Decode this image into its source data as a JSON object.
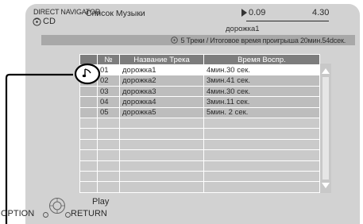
{
  "header": {
    "navigator_label": "DIRECT NAVIGATOR",
    "media_label": "CD",
    "list_title": "Список Музыки",
    "time_start": "0.09",
    "time_end": "4.30",
    "current_track": "дорожка1"
  },
  "summary": "5 Треки / Итоговое время проигрыша 20мин.54dceк.",
  "table": {
    "columns": [
      "№",
      "Название Трека",
      "Время Воспр."
    ],
    "rows": [
      {
        "num": "01",
        "title": "дорожка1",
        "time": "4мин.30 сек."
      },
      {
        "num": "02",
        "title": "дорожка2",
        "time": "3мин.41 сек."
      },
      {
        "num": "03",
        "title": "дорожка3",
        "time": "4мин.30 сек."
      },
      {
        "num": "04",
        "title": "дорожка4",
        "time": "3мин.11 сек."
      },
      {
        "num": "05",
        "title": "дорожка5",
        "time": "5мин.  2 сек."
      }
    ]
  },
  "footer": {
    "play_label": "Play",
    "option_label": "OPTION",
    "return_label": "RETURN"
  }
}
